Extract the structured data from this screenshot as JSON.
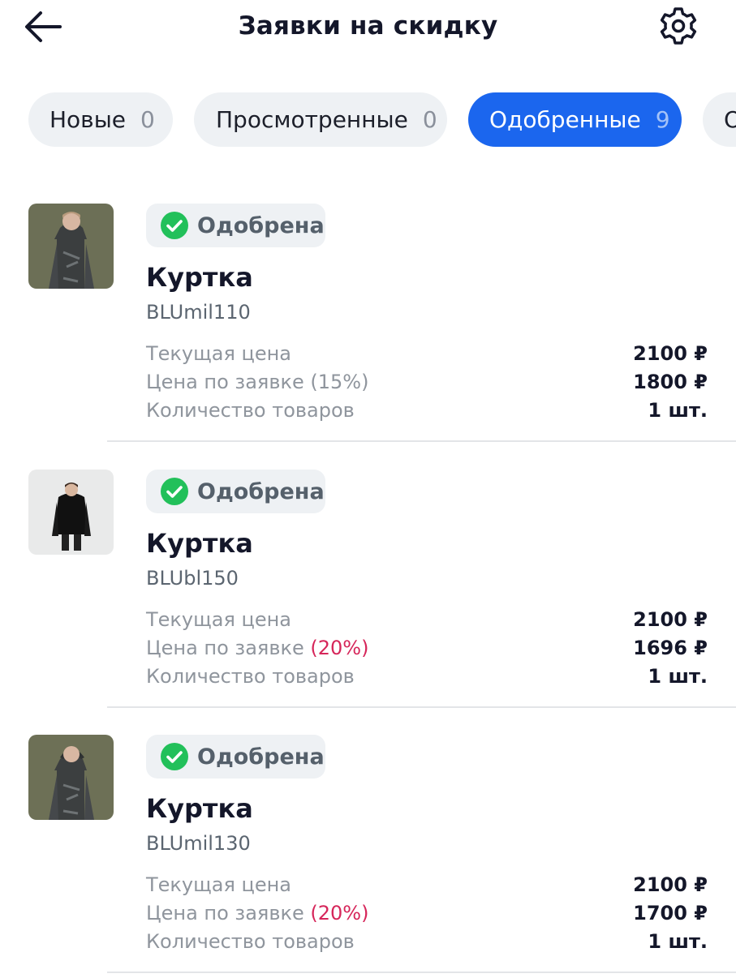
{
  "header": {
    "title": "Заявки на скидку",
    "back_icon": "arrow-left-icon",
    "settings_icon": "gear-icon"
  },
  "tabs": [
    {
      "label": "Новые",
      "count": "0",
      "active": false
    },
    {
      "label": "Просмотренные",
      "count": "0",
      "active": false
    },
    {
      "label": "Одобренные",
      "count": "9",
      "active": true
    },
    {
      "label": "О",
      "count": "",
      "active": false
    }
  ],
  "cards": [
    {
      "status": "Одобрена",
      "name": "Куртка",
      "sku": "BLUmil110",
      "current_price_label": "Текущая цена",
      "current_price": "2100 ₽",
      "request_price_label": "Цена по заявке",
      "request_discount": "(15%)",
      "request_discount_highlighted": false,
      "request_price": "1800 ₽",
      "qty_label": "Количество товаров",
      "qty": "1 шт."
    },
    {
      "status": "Одобрена",
      "name": "Куртка",
      "sku": "BLUbl150",
      "current_price_label": "Текущая цена",
      "current_price": "2100 ₽",
      "request_price_label": "Цена по заявке",
      "request_discount": "(20%)",
      "request_discount_highlighted": true,
      "request_price": "1696 ₽",
      "qty_label": "Количество товаров",
      "qty": "1 шт."
    },
    {
      "status": "Одобрена",
      "name": "Куртка",
      "sku": "BLUmil130",
      "current_price_label": "Текущая цена",
      "current_price": "2100 ₽",
      "request_price_label": "Цена по заявке",
      "request_discount": "(20%)",
      "request_discount_highlighted": true,
      "request_price": "1700 ₽",
      "qty_label": "Количество товаров",
      "qty": "1 шт."
    }
  ],
  "colors": {
    "accent": "#1b66ee",
    "approved_green": "#22c05a",
    "discount_red": "#d6265a"
  }
}
